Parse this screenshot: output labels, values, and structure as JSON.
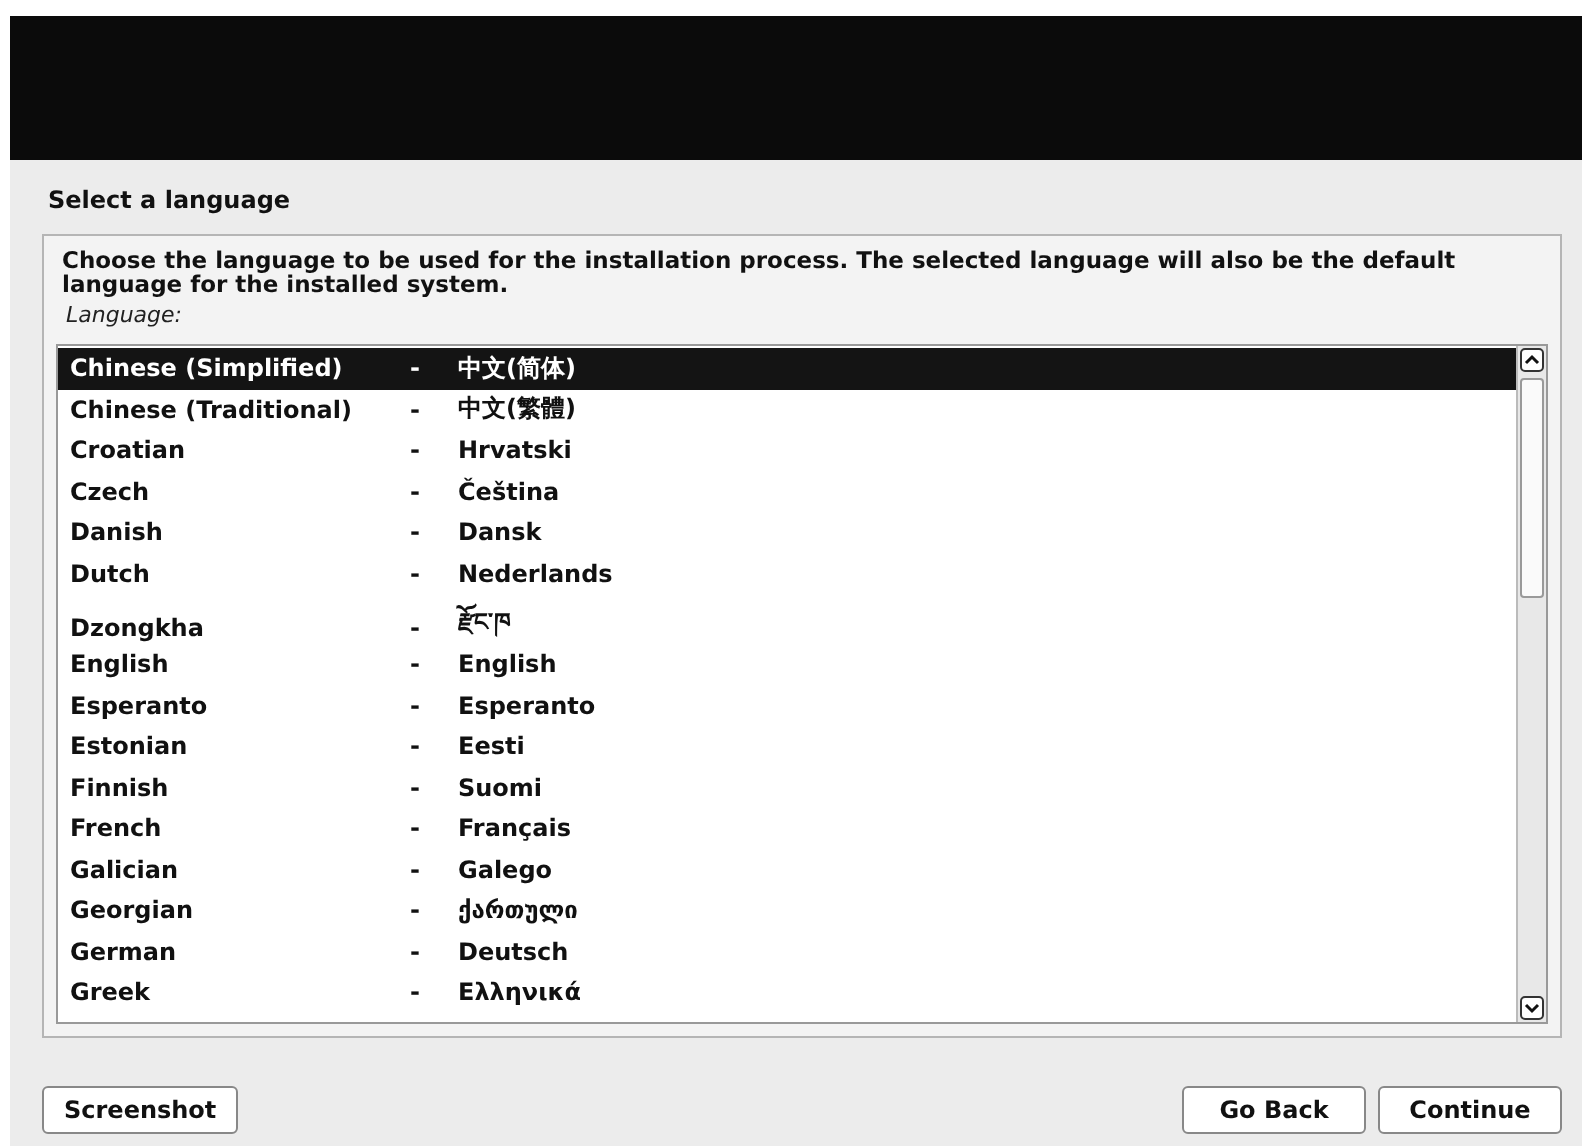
{
  "page_title": "Select a language",
  "instructions": "Choose the language to be used for the installation process. The selected language will also be the default language for the installed system.",
  "list_label": "Language:",
  "languages": [
    {
      "name": "Chinese (Simplified)",
      "separator": "-",
      "native": "中文(简体)",
      "selected": true
    },
    {
      "name": "Chinese (Traditional)",
      "separator": "-",
      "native": "中文(繁體)",
      "selected": false
    },
    {
      "name": "Croatian",
      "separator": "-",
      "native": "Hrvatski",
      "selected": false
    },
    {
      "name": "Czech",
      "separator": "-",
      "native": "Čeština",
      "selected": false
    },
    {
      "name": "Danish",
      "separator": "-",
      "native": "Dansk",
      "selected": false
    },
    {
      "name": "Dutch",
      "separator": "-",
      "native": "Nederlands",
      "selected": false
    },
    {
      "name": "Dzongkha",
      "separator": "-",
      "native": "རྫོང་ཁ",
      "selected": false
    },
    {
      "name": "English",
      "separator": "-",
      "native": "English",
      "selected": false
    },
    {
      "name": "Esperanto",
      "separator": "-",
      "native": "Esperanto",
      "selected": false
    },
    {
      "name": "Estonian",
      "separator": "-",
      "native": "Eesti",
      "selected": false
    },
    {
      "name": "Finnish",
      "separator": "-",
      "native": "Suomi",
      "selected": false
    },
    {
      "name": "French",
      "separator": "-",
      "native": "Français",
      "selected": false
    },
    {
      "name": "Galician",
      "separator": "-",
      "native": "Galego",
      "selected": false
    },
    {
      "name": "Georgian",
      "separator": "-",
      "native": "ქართული",
      "selected": false
    },
    {
      "name": "German",
      "separator": "-",
      "native": "Deutsch",
      "selected": false
    },
    {
      "name": "Greek",
      "separator": "-",
      "native": "Ελληνικά",
      "selected": false
    }
  ],
  "buttons": {
    "left": [
      "Screenshot"
    ],
    "right": [
      "Go Back",
      "Continue"
    ]
  }
}
